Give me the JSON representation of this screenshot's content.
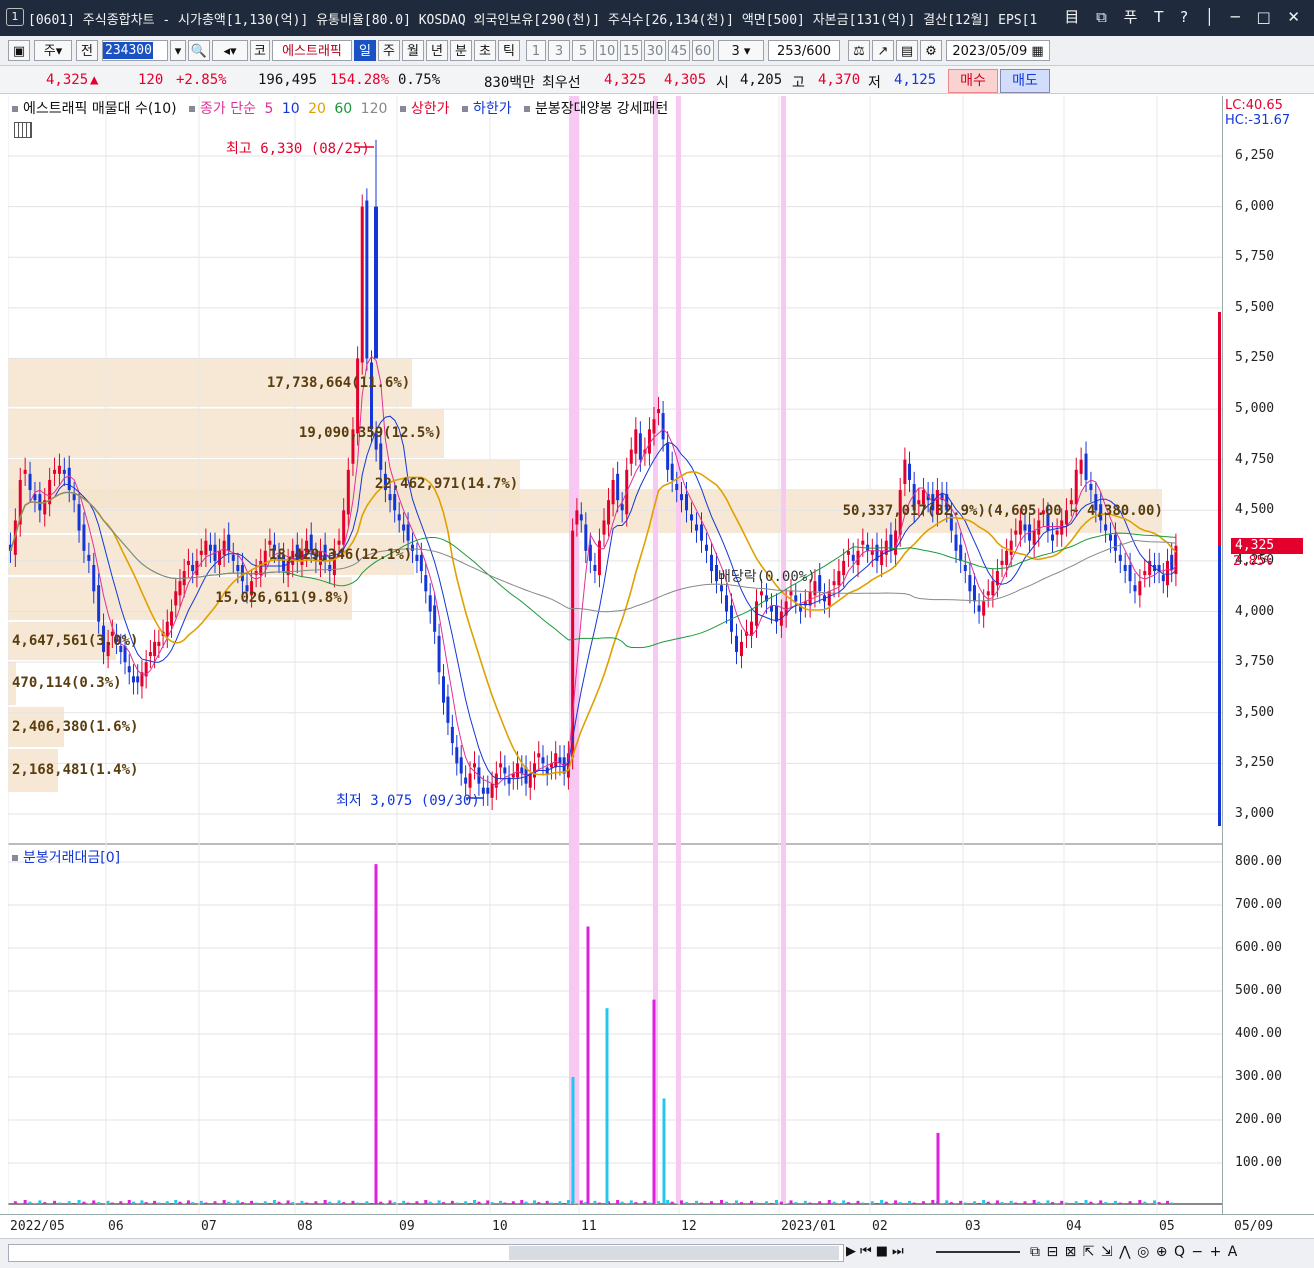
{
  "window": {
    "number": "1",
    "title": "[0601] 주식종합차트 - 시가총액[1,130(억)] 유통비율[80.0] KOSDAQ 외국인보유[290(천)] 주식수[26,134(천)] 액면[500] 자본금[131(억)] 결산[12월] EPS[1",
    "controls": "目 ⧉ 푸 T ? │ ─ □ ✕"
  },
  "toolbar": {
    "type_label": "주",
    "prev_label": "전",
    "code": "234300",
    "market_label": "코",
    "stock_name": "에스트래픽",
    "periods": [
      "일",
      "주",
      "월",
      "년",
      "분",
      "초",
      "틱"
    ],
    "selected_period": "일",
    "intervals": [
      "1",
      "3",
      "5",
      "10",
      "15",
      "30",
      "45",
      "60"
    ],
    "interval_value": "3",
    "count": "253",
    "max_count": "/600",
    "date": "2023/05/09"
  },
  "quote": {
    "price": "4,325",
    "up_symbol": "▲",
    "change": "120",
    "change_pct": "+2.85%",
    "volume": "196,495",
    "volume_ratio": "154.28%",
    "turnover": "0.75%",
    "amount": "830백만",
    "best_bid_label": "최우선",
    "ask": "4,325",
    "bid": "4,305",
    "open_label": "시",
    "open": "4,205",
    "high_label": "고",
    "high": "4,370",
    "low_label": "저",
    "low": "4,125",
    "buy_label": "매수",
    "sell_label": "매도"
  },
  "legend": {
    "profile": "에스트래픽 매물대 수(10)",
    "ma_label": "종가 단순",
    "ma5": "5",
    "ma10": "10",
    "ma20": "20",
    "ma60": "60",
    "ma120": "120",
    "upper_limit": "상한가",
    "lower_limit": "하한가",
    "pattern": "분봉장대양봉 강세패턴"
  },
  "lc_hc": {
    "lc": "LC:40.65",
    "hc": "HC:-31.67"
  },
  "price_axis": [
    "6,250",
    "6,000",
    "5,750",
    "5,500",
    "5,250",
    "5,000",
    "4,750",
    "4,500",
    "4,250",
    "4,000",
    "3,750",
    "3,500",
    "3,250",
    "3,000"
  ],
  "current_price_tag": {
    "price": "4,325",
    "pct": "2.85%"
  },
  "volume_profile": [
    {
      "label": "17,738,664(11.6%)",
      "price_low": 5000,
      "price_high": 5250
    },
    {
      "label": "19,090,359(12.5%)",
      "price_low": 4750,
      "price_high": 5000
    },
    {
      "label": "22,462,971(14.7%)",
      "price_low": 4500,
      "price_high": 4750
    },
    {
      "label": "50,337,017(32.9%)(4,605.00 ~ 4,380.00)",
      "price_low": 4380,
      "price_high": 4605
    },
    {
      "label": "18,429,346(12.1%)",
      "price_low": 4170,
      "price_high": 4380
    },
    {
      "label": "15,026,611(9.8%)",
      "price_low": 3950,
      "price_high": 4170
    },
    {
      "label": "4,647,561(3.0%)",
      "price_low": 3750,
      "price_high": 3950
    },
    {
      "label": "470,114(0.3%)",
      "price_low": 3530,
      "price_high": 3750
    },
    {
      "label": "2,406,380(1.6%)",
      "price_low": 3320,
      "price_high": 3530
    },
    {
      "label": "2,168,481(1.4%)",
      "price_low": 3100,
      "price_high": 3320
    }
  ],
  "annotations": {
    "high_label": "최고 6,330 (08/25)",
    "low_label": "최저 3,075 (09/30)",
    "dividend_label": "배당락(0.00%)"
  },
  "sub_chart": {
    "title": "분봉거래대금[0]",
    "axis": [
      "800.00",
      "700.00",
      "600.00",
      "500.00",
      "400.00",
      "300.00",
      "200.00",
      "100.00"
    ]
  },
  "x_axis": [
    "2022/05",
    "06",
    "07",
    "08",
    "09",
    "10",
    "11",
    "12",
    "2023/01",
    "02",
    "03",
    "04",
    "05"
  ],
  "x_axis_right": "05/09",
  "status": {
    "tools": "⧉ ⊟ ⊠ ⇱ ⇲ ⋀ ◎ ⊕ Q − + A"
  },
  "chart_data": {
    "type": "candlestick",
    "title": "에스트래픽",
    "ylim": [
      2950,
      6350
    ],
    "x_range": [
      "2022/05/02",
      "2023/05/09"
    ],
    "month_labels": [
      "2022/05",
      "06",
      "07",
      "08",
      "09",
      "10",
      "11",
      "12",
      "2023/01",
      "02",
      "03",
      "04",
      "05"
    ],
    "highest": {
      "value": 6330,
      "date": "08/25"
    },
    "lowest": {
      "value": 3075,
      "date": "09/30"
    },
    "last_close": 4325,
    "close_series_by_month": [
      {
        "month": "2022/05",
        "close": [
          4300,
          4450,
          4650,
          4700,
          4600,
          4550,
          4500,
          4550,
          4650,
          4700,
          4720,
          4680,
          4600,
          4550,
          4400,
          4300,
          4250,
          4100,
          3950,
          3800
        ]
      },
      {
        "month": "2022/06",
        "close": [
          3850,
          3900,
          3850,
          3800,
          3750,
          3700,
          3650,
          3650,
          3700,
          3750,
          3800,
          3850,
          3850,
          3900,
          3950,
          4000,
          4100,
          4150,
          4200,
          4250,
          4200,
          4250
        ]
      },
      {
        "month": "2022/07",
        "close": [
          4300,
          4350,
          4300,
          4250,
          4300,
          4350,
          4300,
          4250,
          4200,
          4150,
          4100,
          4150,
          4200,
          4250,
          4300,
          4350,
          4300,
          4250,
          4200,
          4250,
          4300
        ]
      },
      {
        "month": "2022/08",
        "close": [
          4250,
          4300,
          4350,
          4300,
          4250,
          4300,
          4250,
          4200,
          4300,
          4350,
          4500,
          4700,
          4900,
          5250,
          6000,
          5250,
          4900,
          4800,
          4700,
          4600,
          4550,
          4500
        ]
      },
      {
        "month": "2022/09",
        "close": [
          4450,
          4400,
          4350,
          4300,
          4250,
          4200,
          4100,
          4000,
          3900,
          3700,
          3550,
          3450,
          3350,
          3250,
          3200,
          3150,
          3200,
          3250,
          3150,
          3100,
          3100
        ]
      },
      {
        "month": "2022/10",
        "close": [
          3150,
          3200,
          3250,
          3200,
          3150,
          3200,
          3250,
          3200,
          3150,
          3200,
          3250,
          3300,
          3250,
          3200,
          3250,
          3300,
          3250,
          3200,
          3300,
          4400,
          4500
        ]
      },
      {
        "month": "2022/11",
        "close": [
          4450,
          4300,
          4250,
          4200,
          4350,
          4450,
          4550,
          4650,
          4550,
          4500,
          4700,
          4800,
          4900,
          4750,
          4800,
          4900,
          4950,
          5000,
          4850,
          4700,
          4650,
          4600
        ]
      },
      {
        "month": "2022/12",
        "close": [
          4550,
          4500,
          4450,
          4400,
          4350,
          4300,
          4200,
          4150,
          4100,
          4000,
          3900,
          3800,
          3850,
          3900,
          3950,
          4050,
          4100,
          4050,
          4000,
          3950
        ]
      },
      {
        "month": "2023/01",
        "close": [
          4000,
          4050,
          4100,
          4050,
          4000,
          4050,
          4100,
          4150,
          4100,
          4050,
          4100,
          4150,
          4200,
          4250,
          4300,
          4250,
          4300,
          4350,
          4300
        ]
      },
      {
        "month": "2023/02",
        "close": [
          4300,
          4250,
          4300,
          4350,
          4300,
          4400,
          4600,
          4750,
          4650,
          4500,
          4550,
          4600,
          4550,
          4500,
          4600,
          4550,
          4500,
          4400,
          4300,
          4250
        ]
      },
      {
        "month": "2023/03",
        "close": [
          4200,
          4100,
          4050,
          4000,
          4050,
          4100,
          4150,
          4200,
          4250,
          4300,
          4350,
          4400,
          4450,
          4400,
          4350,
          4400,
          4450,
          4500,
          4400,
          4350,
          4400,
          4450
        ]
      },
      {
        "month": "2023/04",
        "close": [
          4500,
          4550,
          4700,
          4750,
          4650,
          4600,
          4500,
          4450,
          4400,
          4350,
          4300,
          4250,
          4200,
          4150,
          4100,
          4150,
          4200,
          4250,
          4200
        ]
      },
      {
        "month": "2023/05",
        "close": [
          4200,
          4150,
          4250,
          4205,
          4325
        ]
      }
    ],
    "turnover_spikes": [
      {
        "month": "2022/08",
        "value": 795
      },
      {
        "month": "2022/10",
        "value": 300
      },
      {
        "month": "2022/11",
        "value": 650
      },
      {
        "month": "2022/11",
        "value": 460
      },
      {
        "month": "2022/11",
        "value": 480
      },
      {
        "month": "2023/02",
        "value": 250
      },
      {
        "month": "2023/04",
        "value": 170
      }
    ]
  }
}
